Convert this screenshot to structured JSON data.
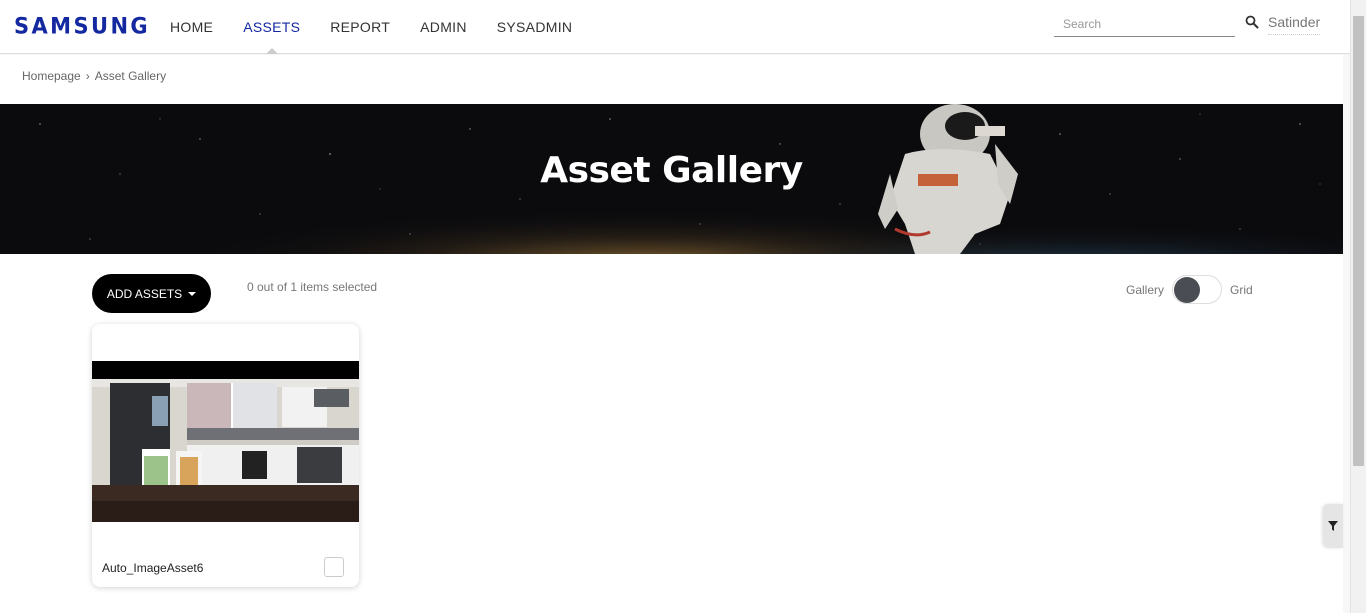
{
  "brand": {
    "logo_text": "SAMSUNG",
    "color": "#1428a0"
  },
  "nav": {
    "items": [
      {
        "label": "HOME",
        "active": false
      },
      {
        "label": "ASSETS",
        "active": true
      },
      {
        "label": "REPORT",
        "active": false
      },
      {
        "label": "ADMIN",
        "active": false
      },
      {
        "label": "SYSADMIN",
        "active": false
      }
    ]
  },
  "search": {
    "placeholder": "Search",
    "value": "",
    "icon": "search-icon"
  },
  "user": {
    "name": "Satinder"
  },
  "breadcrumb": {
    "home": "Homepage",
    "separator": "›",
    "current": "Asset Gallery"
  },
  "banner": {
    "title": "Asset Gallery"
  },
  "toolbar": {
    "add_assets_label": "ADD ASSETS",
    "selection_text": "0 out of 1 items selected",
    "toggle_left_label": "Gallery",
    "toggle_right_label": "Grid",
    "toggle_state": "Gallery"
  },
  "assets": [
    {
      "name": "Auto_ImageAsset6",
      "selected": false
    }
  ],
  "filter": {
    "icon": "filter-icon"
  }
}
